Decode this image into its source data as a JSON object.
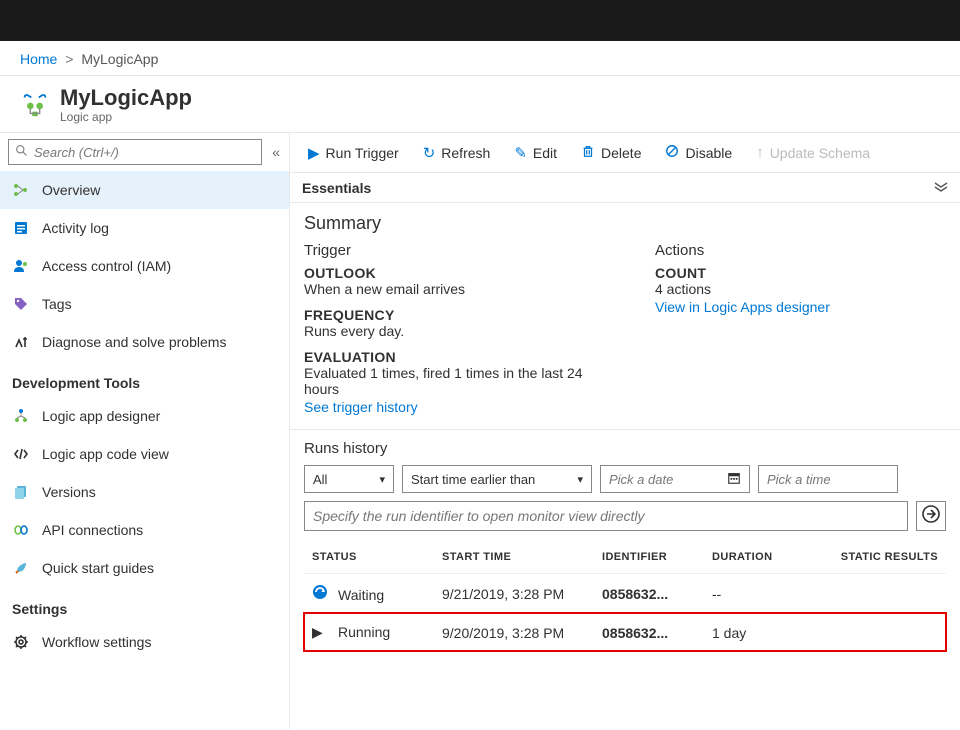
{
  "breadcrumb": {
    "home": "Home",
    "current": "MyLogicApp"
  },
  "header": {
    "title": "MyLogicApp",
    "subtitle": "Logic app"
  },
  "search": {
    "placeholder": "Search (Ctrl+/)"
  },
  "nav": {
    "items": [
      {
        "label": "Overview"
      },
      {
        "label": "Activity log"
      },
      {
        "label": "Access control (IAM)"
      },
      {
        "label": "Tags"
      },
      {
        "label": "Diagnose and solve problems"
      }
    ],
    "section_dev": "Development Tools",
    "dev_items": [
      {
        "label": "Logic app designer"
      },
      {
        "label": "Logic app code view"
      },
      {
        "label": "Versions"
      },
      {
        "label": "API connections"
      },
      {
        "label": "Quick start guides"
      }
    ],
    "section_settings": "Settings",
    "settings_items": [
      {
        "label": "Workflow settings"
      }
    ]
  },
  "toolbar": {
    "run": "Run Trigger",
    "refresh": "Refresh",
    "edit": "Edit",
    "delete": "Delete",
    "disable": "Disable",
    "update": "Update Schema"
  },
  "essentials": {
    "label": "Essentials"
  },
  "summary": {
    "heading": "Summary",
    "trigger_label": "Trigger",
    "actions_label": "Actions",
    "trigger": {
      "outlook_h": "OUTLOOK",
      "outlook_v": "When a new email arrives",
      "freq_h": "FREQUENCY",
      "freq_v": "Runs every day.",
      "eval_h": "EVALUATION",
      "eval_v": "Evaluated 1 times, fired 1 times in the last 24 hours",
      "history_link": "See trigger history"
    },
    "actions": {
      "count_h": "COUNT",
      "count_v": "4 actions",
      "designer_link": "View in Logic Apps designer"
    }
  },
  "runs": {
    "title": "Runs history",
    "filter_all": "All",
    "filter_start": "Start time earlier than",
    "date_ph": "Pick a date",
    "time_ph": "Pick a time",
    "id_ph": "Specify the run identifier to open monitor view directly",
    "cols": {
      "status": "STATUS",
      "start": "START TIME",
      "id": "IDENTIFIER",
      "dur": "DURATION",
      "static": "STATIC RESULTS"
    },
    "rows": [
      {
        "status": "Waiting",
        "start": "9/21/2019, 3:28 PM",
        "id": "0858632...",
        "dur": "--"
      },
      {
        "status": "Running",
        "start": "9/20/2019, 3:28 PM",
        "id": "0858632...",
        "dur": "1 day"
      }
    ]
  }
}
